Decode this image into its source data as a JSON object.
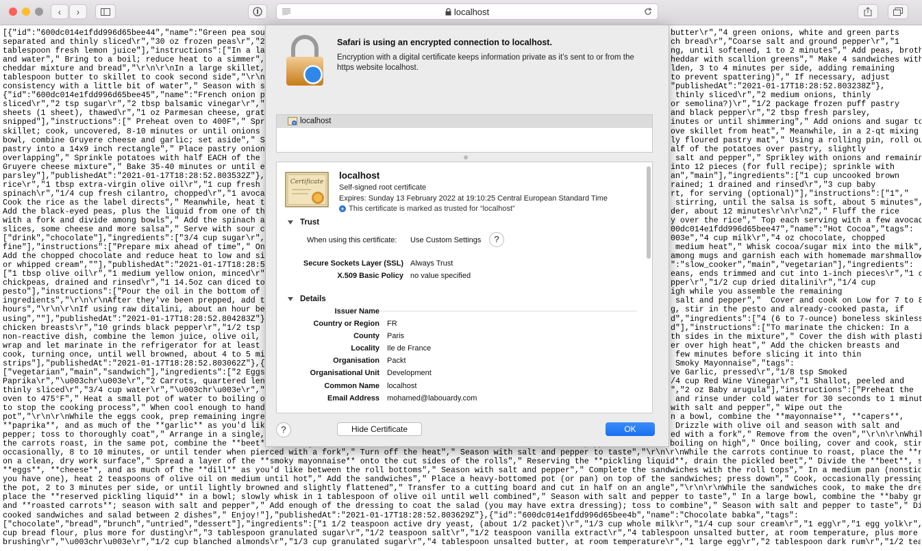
{
  "browser": {
    "url": "localhost",
    "colors": {
      "close": "#fe5f57",
      "minimize": "#febc2e",
      "zoom": "#9a9a9a"
    },
    "icons": [
      "back-icon",
      "forward-icon",
      "sidebar-icon",
      "privacy-icon",
      "reader-icon",
      "lock-icon",
      "reload-icon",
      "share-icon",
      "tabs-icon"
    ]
  },
  "page_text": [
    "[{\"id\":\"600dc014e1fdd996d65bee44\",\"name\":\"Green pea soup w",
    "separated and thinly sliced\\r\",\"30 oz frozen peas\\r\",\"2",
    "tablespoon fresh lemon juice\"],\"instructions\":[\"In a large",
    "and water\",\" Bring to a boil; reduce heat to a simmer\",\" C",
    "cheddar mixture and bread\",\"\\r\\n\\r\\nIn a large skillet, he",
    "tablespoon butter to skillet to cook second side\",\"\\r\\n\\r\\",
    "consistency with a little bit of water\",\" Season with salt",
    "{\"id\":\"600dc014e1fdd996d65bee45\",\"name\":\"French onion pota",
    "sliced\\r\",\"2 tsp sugar\\r\",\"2 tbsp balsamic vinegar\\r\",\"5 c",
    "sheets (1 sheet), thawed\\r\",\"1 oz Parmesan cheese, grated\\",
    "snipped\"],\"instructions\":[\" Preheat oven to 400F\",\" Spray",
    "skillet; cook, uncovered, 8-10 minutes or until onions are",
    "bowl, combine Gruyere cheese and garlic; set aside\",\" Spri",
    "pastry into a 14x9 inch rectangle\",\" Place pastry onion pr",
    "overlapping\",\" Sprinkle potatoes with half EACH of the ros",
    "Gruyere cheese mixture\",\" Bake 35-40 minutes or until edge",
    "parsley\"],\"publishedAt\":\"2021-01-17T18:28:52.803532Z\"},{\"i",
    "rice\\r\",\"1 tbsp extra-virgin olive oil\\r\",\"1 cup fresh sal",
    "spinach\\r\",\"1/4 cup fresh cilantro, chopped\\r\",\"1 avocado,",
    "Cook the rice as the label directs\",\" Meanwhile, heat the",
    "Add the black-eyed peas, plus the liquid from one of the c",
    "with a fork and divide among bowls\",\" Add the spinach and",
    "slices, some cheese and more salsa\",\" Serve with sour crea",
    "[\"drink\",\"chocolate\"],\"ingredients\":[\"3/4 cup sugar\\r\",\"1/",
    "fine\"],\"instructions\":[\"Prepare mix ahead of time\",\" One s",
    "Add the chopped chocolate and reduce heat to low and simme",
    "or whipped cream\",\"\"],\"publishedAt\":\"2021-01-17T18:28:52.8",
    "[\"1 tbsp olive oil\\r\",\"1 medium yellow onion, minced\\r\",\"1",
    "chickpeas, drained and rinsed\\r\",\"1 14.5oz can diced tomat",
    "pesto\"],\"instructions\":[\"Pour the oil in the bottom of a 4",
    "ingredients\",\"\\r\\n\\r\\nAfter they've been prepped, add the",
    "hours\",\"\\r\\n\\r\\nIf using raw ditalini, about an hour befor",
    "using\",\"\"],\"publishedAt\":\"2021-01-17T18:28:52.804283Z\"},{\"i",
    "chicken breasts\\r\",\"10 grinds black pepper\\r\",\"1/2 tsp sal",
    "non-reactive dish, combine the lemon juice, olive oil, ore",
    "wrap and let marinate in the refrigerator for at least 30",
    "cook, turning once, until well browned, about 4 to 5 minut",
    "strips\"],\"publishedAt\":\"2021-01-17T18:28:52.803062Z\"},{\"id",
    "[\"vegetarian\",\"main\",\"sandwich\"],\"ingredients\":[\"2 Eggs\\r",
    "Paprika\\r\",\"\\u003chr\\u003e\\r\",\"2 Carrots, quartered length",
    "thinly sliced\\r\",\"3/4 cup water\\r\",\"\\u003chr\\u003e\\r\",\"2 c",
    "oven to 475°F\",\" Heat a small pot of water to boiling on h",
    "to stop the cooking process\",\" When cool enough to handle,",
    "pot\",\"\\r\\n\\r\\nWhile the eggs cook, prep remaining ingredie",
    "**paprika**, and as much of the **garlic** as you'd like\"",
    "pepper; toss to thoroughly coat\",\" Arrange in a single, ev",
    "the carrots roast, in the same pot, combine the **beet**, **vinegar**, **shallot**, and **water**\",\" Season with salt and pepper\",\" Heat to boiling on high\",\" Once boiling, cover and cook, stirring",
    "occasionally, 8 to 10 minutes, or until tender when pierced with a fork\",\" Turn off the heat\",\" Season with salt and pepper to taste\",\"\\r\\n\\r\\nWhile the carrots continue to roast, place the **rolls**",
    "on a clean, dry work surface\",\" Spread a layer of the **smoky mayonnaise** onto the cut sides of the rolls\",\" Reserving the **pickling liquid**, drain the pickled beet\",\" Divide the **beet**, sliced",
    "**eggs**, **cheese**, and as much of the **dill** as you'd like between the roll bottoms\",\" Season with salt and pepper\",\" Complete the sandwiches with the roll tops\",\" In a medium pan (nonstick, if",
    "you have one), heat 2 teaspoons of olive oil on medium until hot\",\" Add the sandwiches\",\" Place a heavy-bottomed pot (or pan) on top of the sandwiches; press down\",\" Cook, occasionally pressing down on",
    "the pot, 2 to 3 minutes per side, or until lightly browned and slightly flattened\",\" Transfer to a cutting board and cut in half on an angle\",\"\\r\\n\\r\\nWhile the sandwiches cook, to make the dressing,",
    "place the **reserved pickling liquid** in a bowl; slowly whisk in 1 tablespoon of olive oil until well combined\",\" Season with salt and pepper to taste\",\" In a large bowl, combine the **baby greens**",
    "and **roasted carrots**; season with salt and pepper\",\" Add enough of the dressing to coat the salad (you may have extra dressing); toss to combine\",\" Season with salt and pepper to taste\",\" Divide the",
    "cooked sandwiches and salad between 2 dishes\",\" Enjoy!\"],\"publishedAt\":\"2021-01-17T18:28:52.803629Z\"},{\"id\":\"600dc014e1fdd996d65bee4b\",\"name\":\"Chocolate babka\",\"tags\":",
    "[\"chocolate\",\"bread\",\"brunch\",\"untried\",\"dessert\"],\"ingredients\":[\"1 1/2 teaspoon active dry yeast, (about 1/2 packet)\\r\",\"1/3 cup whole milk\\r\",\"1/4 cup sour cream\\r\",\"1 egg\\r\",\"1 egg yolk\\r\",\"1 3/4",
    "cup bread flour, plus more for dusting\\r\",\"3 tablespoon granulated sugar\\r\",\"1/2 teaspoon salt\\r\",\"1/2 teaspoon vanilla extract\\r\",\"4 tablespoon unsalted butter, at room temperature, plus more for",
    "brushing\\r\",\"\\u003chr\\u003e\\r\",\"1/2 cup blanched almonds\\r\",\"1/3 cup granulated sugar\\r\",\"4 tablespoon unsalted butter, at room temperature\\r\",\"1 large egg\\r\",\"2 tablespoon dark rum\\r\",\"1/2 teaspoon"
  ],
  "page_text_right": [
    "butter\\r\",\"4 green onions, white and green parts",
    "ch bread\\r\",\"Coarse salt and ground pepper\\r\",\"1",
    "ng, until softened, 1 to 2 minutes\",\" Add peas, broth,",
    "heddar with scallion greens\",\" Make 4 sandwiches with",
    "lden, 3 to 4 minutes per side, adding remaining",
    "to prevent spattering)\",\" If necessary, adjust",
    "\"publishedAt\":\"2021-01-17T18:28:52.803238Z\"},",
    " thinly sliced\\r\",\"2 medium onions, thinly",
    "or semolina?)\\r\",\"1/2 package frozen puff pastry",
    "and black pepper\\r\",\"2 tbsp fresh parsley,",
    "inutes or until shimmering\",\" Add onions and sugar to",
    "ove skillet from heat\",\" Meanwhile, in a 2-qt mixing",
    "ly floured pastry mat\",\" Using a rolling pin, roll out",
    "alf of the potatoes over pastry, slightly",
    " salt and pepper\",\" Sprikley with onions and remaining",
    "into 12 pieces (for full recipe); sprinkle with",
    "an\",\"main\"],\"ingredients\":[\"1 cup uncooked brown",
    "rained; 1 drained and rinsed\\r\",\"3 cup baby",
    "rt, for serving (optional)\"],\"instructions\":[\"1\",\"",
    " stirring, until the salsa is soft, about 5 minutes\",\"",
    "der, about 12 minutes\\r\\n\\r\\n2\",\" Fluff the rice",
    "y over the rice\",\" Top each serving with a few avocado",
    "00dc014e1fdd996d65bee47\",\"name\":\"Hot Cocoa\",\"tags\":",
    "003e\",\"4 cup milk\\r\",\"4 oz chocolate, chopped",
    " medium heat\",\" Whisk cocoa/sugar mix into the milk\",\"",
    "among mugs and garnish each with homemade marshmallows",
    "\":\"slow_cooker\",\"main\",\"vegetarian\"],\"ingredients\":",
    "eans, ends trimmed and cut into 1-inch pieces\\r\",\"1 can",
    "pper\\r\",\"1/2 cup dried ditalini\\r\",\"1/4 cup",
    "igh while you assemble the remaining",
    " salt and pepper\",\"  Cover and cook on Low for 7 to 8",
    "g, stir in the pesto and already-cooked pasta, if",
    "d\",\"ingredients\":[\"4 (6 to 7-ounce) boneless skinless",
    "d\"],\"instructions\":[\"To marinate the chicken: In a",
    "th sides in the mixture\",\" Cover the dish with plastic",
    "er over high heat\",\" Add the chicken breasts and",
    " few minutes before slicing it into thin",
    " Smoky Mayonnaise\",\"tags\":",
    "ve Garlic, pressed\\r\",\"1/8 tsp Smoked",
    "/4 cup Red Wine Vinegar\\r\",\"1 Shallot, peeled and",
    "\",\"2 oz Baby arugula\"],\"instructions\":[\"Preheat the",
    " and rinse under cold water for 30 seconds to 1 minute",
    "with salt and pepper\",\" Wipe out the",
    "n a bowl, combine the **mayonnaise**, **capers**,",
    " Drizzle with olive oil and season with salt and",
    "ed with a fork\",\" Remove from the oven\",\"\\r\\n\\r\\nWhile"
  ],
  "sheet": {
    "title": "Safari is using an encrypted connection to localhost.",
    "description": "Encryption with a digital certificate keeps information private as it’s sent to or from the https website localhost.",
    "cert_list_item": "localhost",
    "cert": {
      "name": "localhost",
      "type": "Self-signed root certificate",
      "expires": "Expires: Sunday 13 February 2022 at 19:10:25 Central European Standard Time",
      "trust_note": "This certificate is marked as trusted for “localhost”",
      "icon_text": "Certificate"
    },
    "trust": {
      "heading": "Trust",
      "when_using_label": "When using this certificate:",
      "when_using_value": "Use Custom Settings",
      "ssl_label": "Secure Sockets Layer (SSL)",
      "ssl_value": "Always Trust",
      "x509_label": "X.509 Basic Policy",
      "x509_value": "no value specified"
    },
    "details": {
      "heading": "Details",
      "issuer_heading": "Issuer Name",
      "rows": [
        {
          "label": "Country or Region",
          "value": "FR"
        },
        {
          "label": "County",
          "value": "Paris"
        },
        {
          "label": "Locality",
          "value": "Ile de France"
        },
        {
          "label": "Organisation",
          "value": "Packt"
        },
        {
          "label": "Organisational Unit",
          "value": "Development"
        },
        {
          "label": "Common Name",
          "value": "localhost"
        },
        {
          "label": "Email Address",
          "value": "mohamed@labouardy.com"
        }
      ]
    },
    "help_label": "?",
    "hide_button": "Hide Certificate",
    "ok_button": "OK"
  }
}
